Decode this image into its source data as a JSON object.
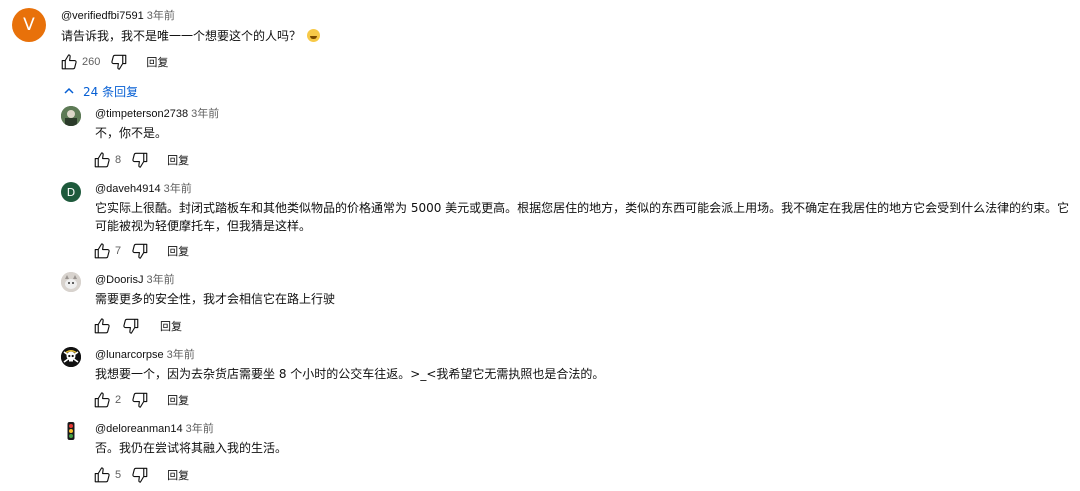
{
  "top_comment": {
    "avatar_letter": "V",
    "avatar_color": "#e8710a",
    "author": "@verifiedfbi7591",
    "time": "3年前",
    "text": "请告诉我，我不是唯一一个想要这个的人吗？",
    "emoji": "😂",
    "likes": "260",
    "reply_label": "回复"
  },
  "replies_toggle": {
    "label": "24 条回复"
  },
  "replies": [
    {
      "author": "@timpeterson2738",
      "time": "3年前",
      "text": "不，你不是。",
      "likes": "8",
      "reply_label": "回复",
      "avatar": "photo-icon"
    },
    {
      "author": "@daveh4914",
      "time": "3年前",
      "text": "它实际上很酷。封闭式踏板车和其他类似物品的价格通常为 5000 美元或更高。根据您居住的地方，类似的东西可能会派上用场。我不确定在我居住的地方它会受到什么法律的约束。它可能被视为轻便摩托车，但我猜是这样。",
      "likes": "7",
      "reply_label": "回复",
      "avatar_letter": "D",
      "avatar_color": "#1e5a3c"
    },
    {
      "author": "@DoorisJ",
      "time": "3年前",
      "text": "需要更多的安全性，我才会相信它在路上行驶",
      "likes": "",
      "reply_label": "回复",
      "avatar": "pet-photo-icon"
    },
    {
      "author": "@lunarcorpse",
      "time": "3年前",
      "text": "我想要一个，因为去杂货店需要坐 8 个小时的公交车往返。>_<我希望它无需执照也是合法的。",
      "likes": "2",
      "reply_label": "回复",
      "avatar": "skull-icon"
    },
    {
      "author": "@deloreanman14",
      "time": "3年前",
      "text": "否。我仍在尝试将其融入我的生活。",
      "likes": "5",
      "reply_label": "回复",
      "avatar": "traffic-light-icon"
    }
  ],
  "colors": {
    "link_blue": "#065fd4",
    "meta_gray": "#606060",
    "text": "#0f0f0f"
  }
}
